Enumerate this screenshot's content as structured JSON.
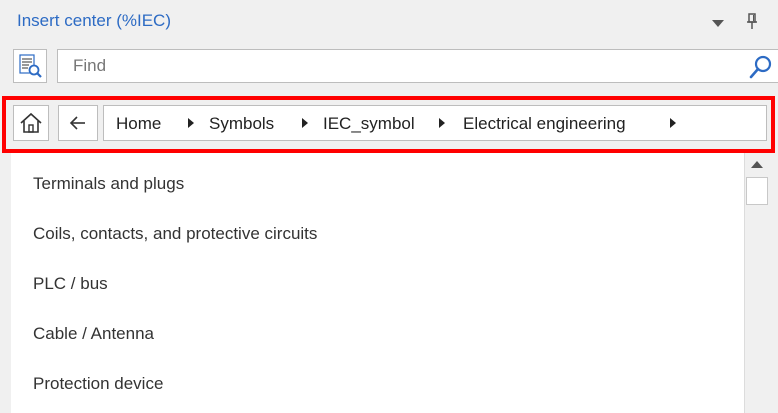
{
  "panel": {
    "title": "Insert center (%IEC)",
    "title_color": "#2d6bc4"
  },
  "title_icons": [
    "chevron-down-icon",
    "pin-icon"
  ],
  "search": {
    "toggle_icon": "list-search-icon",
    "value": "",
    "placeholder": "Find",
    "icon": "search-icon"
  },
  "breadcrumb": {
    "highlight_color": "#ff0000",
    "home_icon": "home-icon",
    "back_icon": "back-arrow-icon",
    "items": [
      "Home",
      "Symbols",
      "IEC_symbol",
      "Electrical engineering"
    ],
    "separator_icon": "triangle-right-icon"
  },
  "list": {
    "items": [
      "Terminals and plugs",
      "Coils, contacts, and protective circuits",
      "PLC / bus",
      "Cable / Antenna",
      "Protection device"
    ]
  }
}
